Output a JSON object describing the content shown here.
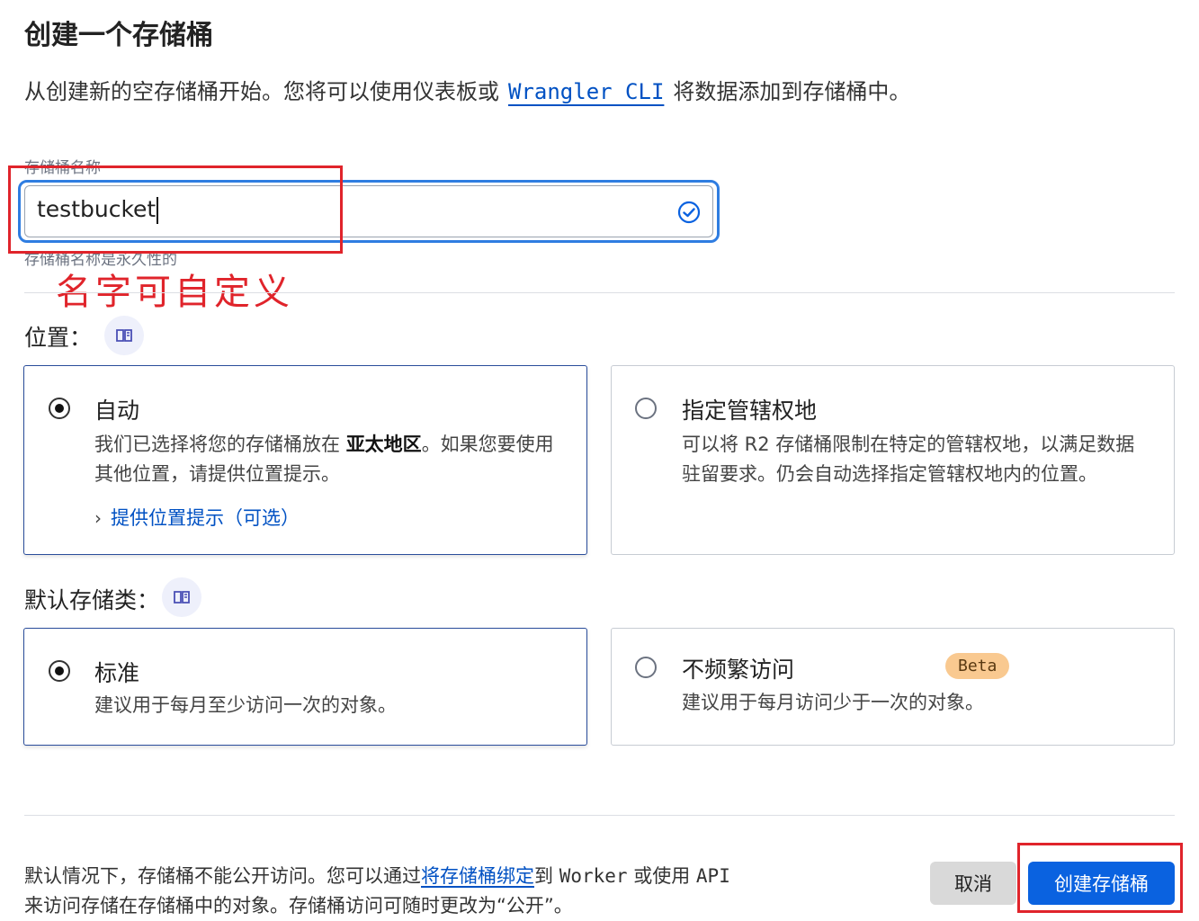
{
  "header": {
    "title": "创建一个存储桶"
  },
  "intro": {
    "before": "从创建新的空存储桶开始。您将可以使用仪表板或",
    "link": "Wrangler CLI",
    "after": "将数据添加到存储桶中。"
  },
  "bucket_name": {
    "label": "存储桶名称",
    "value": "testbucket",
    "help": "存储桶名称是永久性的"
  },
  "annotation": {
    "text": "名字可自定义",
    "color": "#e0242b"
  },
  "location": {
    "label": "位置：",
    "options": [
      {
        "title": "自动",
        "desc_before": "我们已选择将您的存储桶放在 ",
        "desc_bold": "亚太地区",
        "desc_after": "。如果您要使用其他位置，请提供位置提示。",
        "hint_link": "提供位置提示（可选）",
        "selected": true
      },
      {
        "title": "指定管辖权地",
        "desc": "可以将 R2 存储桶限制在特定的管辖权地，以满足数据驻留要求。仍会自动选择指定管辖权地内的位置。",
        "selected": false
      }
    ]
  },
  "storage_class": {
    "label": "默认存储类：",
    "options": [
      {
        "title": "标准",
        "desc": "建议用于每月至少访问一次的对象。",
        "selected": true
      },
      {
        "title": "不频繁访问",
        "badge": "Beta",
        "desc": "建议用于每月访问少于一次的对象。",
        "selected": false
      }
    ]
  },
  "footer": {
    "text_1": "默认情况下，存储桶不能公开访问。您可以通过",
    "link": "将存储桶绑定",
    "text_2": "到 ",
    "mono_1": "Worker",
    "text_3": " 或使用 ",
    "mono_2": "API",
    "line_2": "来访问存储在存储桶中的对象。存储桶访问可随时更改为“公开”。",
    "cancel_label": "取消",
    "create_label": "创建存储桶"
  },
  "colors": {
    "accent": "#0a62e0",
    "link": "#0051c3",
    "focus": "#2f7de1",
    "annotation": "#e0242b"
  }
}
